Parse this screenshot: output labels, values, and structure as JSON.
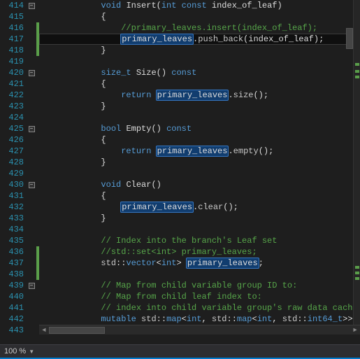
{
  "status": {
    "zoom": "100 %"
  },
  "lines": [
    {
      "num": "414",
      "fold": "−",
      "change": false,
      "indent": 1,
      "tokens": [
        [
          "kw",
          "void"
        ],
        [
          "",
          " "
        ],
        [
          "func",
          "Insert"
        ],
        [
          "",
          "("
        ],
        [
          "kw",
          "int"
        ],
        [
          "",
          " "
        ],
        [
          "kw",
          "const"
        ],
        [
          "",
          " index_of_leaf)"
        ]
      ]
    },
    {
      "num": "415",
      "fold": "",
      "change": false,
      "indent": 1,
      "tokens": [
        [
          "",
          "{"
        ]
      ]
    },
    {
      "num": "416",
      "fold": "",
      "change": true,
      "indent": 2,
      "tokens": [
        [
          "comment",
          "//primary_leaves.insert(index_of_leaf);"
        ]
      ]
    },
    {
      "num": "417",
      "fold": "",
      "change": true,
      "indent": 2,
      "current": true,
      "tokens": [
        [
          "hl",
          "primary_leaves"
        ],
        [
          "",
          "."
        ],
        [
          "call",
          "push_back"
        ],
        [
          "",
          "(index_of_leaf);"
        ]
      ]
    },
    {
      "num": "418",
      "fold": "",
      "change": true,
      "indent": 1,
      "tokens": [
        [
          "",
          "}"
        ]
      ]
    },
    {
      "num": "419",
      "fold": "",
      "change": false,
      "indent": 0,
      "tokens": []
    },
    {
      "num": "420",
      "fold": "−",
      "change": false,
      "indent": 1,
      "tokens": [
        [
          "type",
          "size_t"
        ],
        [
          "",
          " "
        ],
        [
          "func",
          "Size"
        ],
        [
          "",
          "() "
        ],
        [
          "kw",
          "const"
        ]
      ]
    },
    {
      "num": "421",
      "fold": "",
      "change": false,
      "indent": 1,
      "tokens": [
        [
          "",
          "{"
        ]
      ]
    },
    {
      "num": "422",
      "fold": "",
      "change": false,
      "indent": 2,
      "tokens": [
        [
          "kw",
          "return"
        ],
        [
          "",
          " "
        ],
        [
          "hl",
          "primary_leaves"
        ],
        [
          "",
          "."
        ],
        [
          "call",
          "size"
        ],
        [
          "",
          "();"
        ]
      ]
    },
    {
      "num": "423",
      "fold": "",
      "change": false,
      "indent": 1,
      "tokens": [
        [
          "",
          "}"
        ]
      ]
    },
    {
      "num": "424",
      "fold": "",
      "change": false,
      "indent": 0,
      "tokens": []
    },
    {
      "num": "425",
      "fold": "−",
      "change": false,
      "indent": 1,
      "tokens": [
        [
          "kw",
          "bool"
        ],
        [
          "",
          " "
        ],
        [
          "func",
          "Empty"
        ],
        [
          "",
          "() "
        ],
        [
          "kw",
          "const"
        ]
      ]
    },
    {
      "num": "426",
      "fold": "",
      "change": false,
      "indent": 1,
      "tokens": [
        [
          "",
          "{"
        ]
      ]
    },
    {
      "num": "427",
      "fold": "",
      "change": false,
      "indent": 2,
      "tokens": [
        [
          "kw",
          "return"
        ],
        [
          "",
          " "
        ],
        [
          "hl",
          "primary_leaves"
        ],
        [
          "",
          "."
        ],
        [
          "call",
          "empty"
        ],
        [
          "",
          "();"
        ]
      ]
    },
    {
      "num": "428",
      "fold": "",
      "change": false,
      "indent": 1,
      "tokens": [
        [
          "",
          "}"
        ]
      ]
    },
    {
      "num": "429",
      "fold": "",
      "change": false,
      "indent": 0,
      "tokens": []
    },
    {
      "num": "430",
      "fold": "−",
      "change": false,
      "indent": 1,
      "tokens": [
        [
          "kw",
          "void"
        ],
        [
          "",
          " "
        ],
        [
          "func",
          "Clear"
        ],
        [
          "",
          "()"
        ]
      ]
    },
    {
      "num": "431",
      "fold": "",
      "change": false,
      "indent": 1,
      "tokens": [
        [
          "",
          "{"
        ]
      ]
    },
    {
      "num": "432",
      "fold": "",
      "change": false,
      "indent": 2,
      "tokens": [
        [
          "hl",
          "primary_leaves"
        ],
        [
          "",
          "."
        ],
        [
          "call",
          "clear"
        ],
        [
          "",
          "();"
        ]
      ]
    },
    {
      "num": "433",
      "fold": "",
      "change": false,
      "indent": 1,
      "tokens": [
        [
          "",
          "}"
        ]
      ]
    },
    {
      "num": "434",
      "fold": "",
      "change": false,
      "indent": 0,
      "tokens": []
    },
    {
      "num": "435",
      "fold": "",
      "change": false,
      "indent": 1,
      "tokens": [
        [
          "comment",
          "// Index into the branch's Leaf set"
        ]
      ]
    },
    {
      "num": "436",
      "fold": "",
      "change": true,
      "indent": 1,
      "tokens": [
        [
          "comment",
          "//std::set<int> primary_leaves;"
        ]
      ]
    },
    {
      "num": "437",
      "fold": "",
      "change": true,
      "indent": 1,
      "tokens": [
        [
          "ns",
          "std"
        ],
        [
          "",
          "::"
        ],
        [
          "type",
          "vector"
        ],
        [
          "",
          "<"
        ],
        [
          "kw",
          "int"
        ],
        [
          "",
          "> "
        ],
        [
          "hl",
          "primary_leaves"
        ],
        [
          "",
          ";"
        ]
      ]
    },
    {
      "num": "438",
      "fold": "",
      "change": true,
      "indent": 0,
      "tokens": []
    },
    {
      "num": "439",
      "fold": "−",
      "change": false,
      "indent": 1,
      "tokens": [
        [
          "comment",
          "// Map from child variable group ID to:"
        ]
      ]
    },
    {
      "num": "440",
      "fold": "",
      "change": false,
      "indent": 1,
      "tokens": [
        [
          "comment",
          "// Map from child leaf index to:"
        ]
      ]
    },
    {
      "num": "441",
      "fold": "",
      "change": false,
      "indent": 1,
      "tokens": [
        [
          "comment",
          "// index into child variable group's raw data cache"
        ]
      ]
    },
    {
      "num": "442",
      "fold": "",
      "change": false,
      "indent": 1,
      "tokens": [
        [
          "kw",
          "mutable"
        ],
        [
          "",
          " "
        ],
        [
          "ns",
          "std"
        ],
        [
          "",
          "::"
        ],
        [
          "type",
          "map"
        ],
        [
          "",
          "<"
        ],
        [
          "kw",
          "int"
        ],
        [
          "",
          ", "
        ],
        [
          "ns",
          "std"
        ],
        [
          "",
          "::"
        ],
        [
          "type",
          "map"
        ],
        [
          "",
          "<"
        ],
        [
          "kw",
          "int"
        ],
        [
          "",
          ", "
        ],
        [
          "ns",
          "std"
        ],
        [
          "",
          "::"
        ],
        [
          "type",
          "int64_t"
        ],
        [
          "",
          ">>"
        ]
      ]
    },
    {
      "num": "443",
      "fold": "",
      "change": false,
      "indent": 0,
      "tokens": []
    }
  ],
  "minimap_marks": [
    90,
    100,
    108,
    380,
    388,
    396
  ]
}
